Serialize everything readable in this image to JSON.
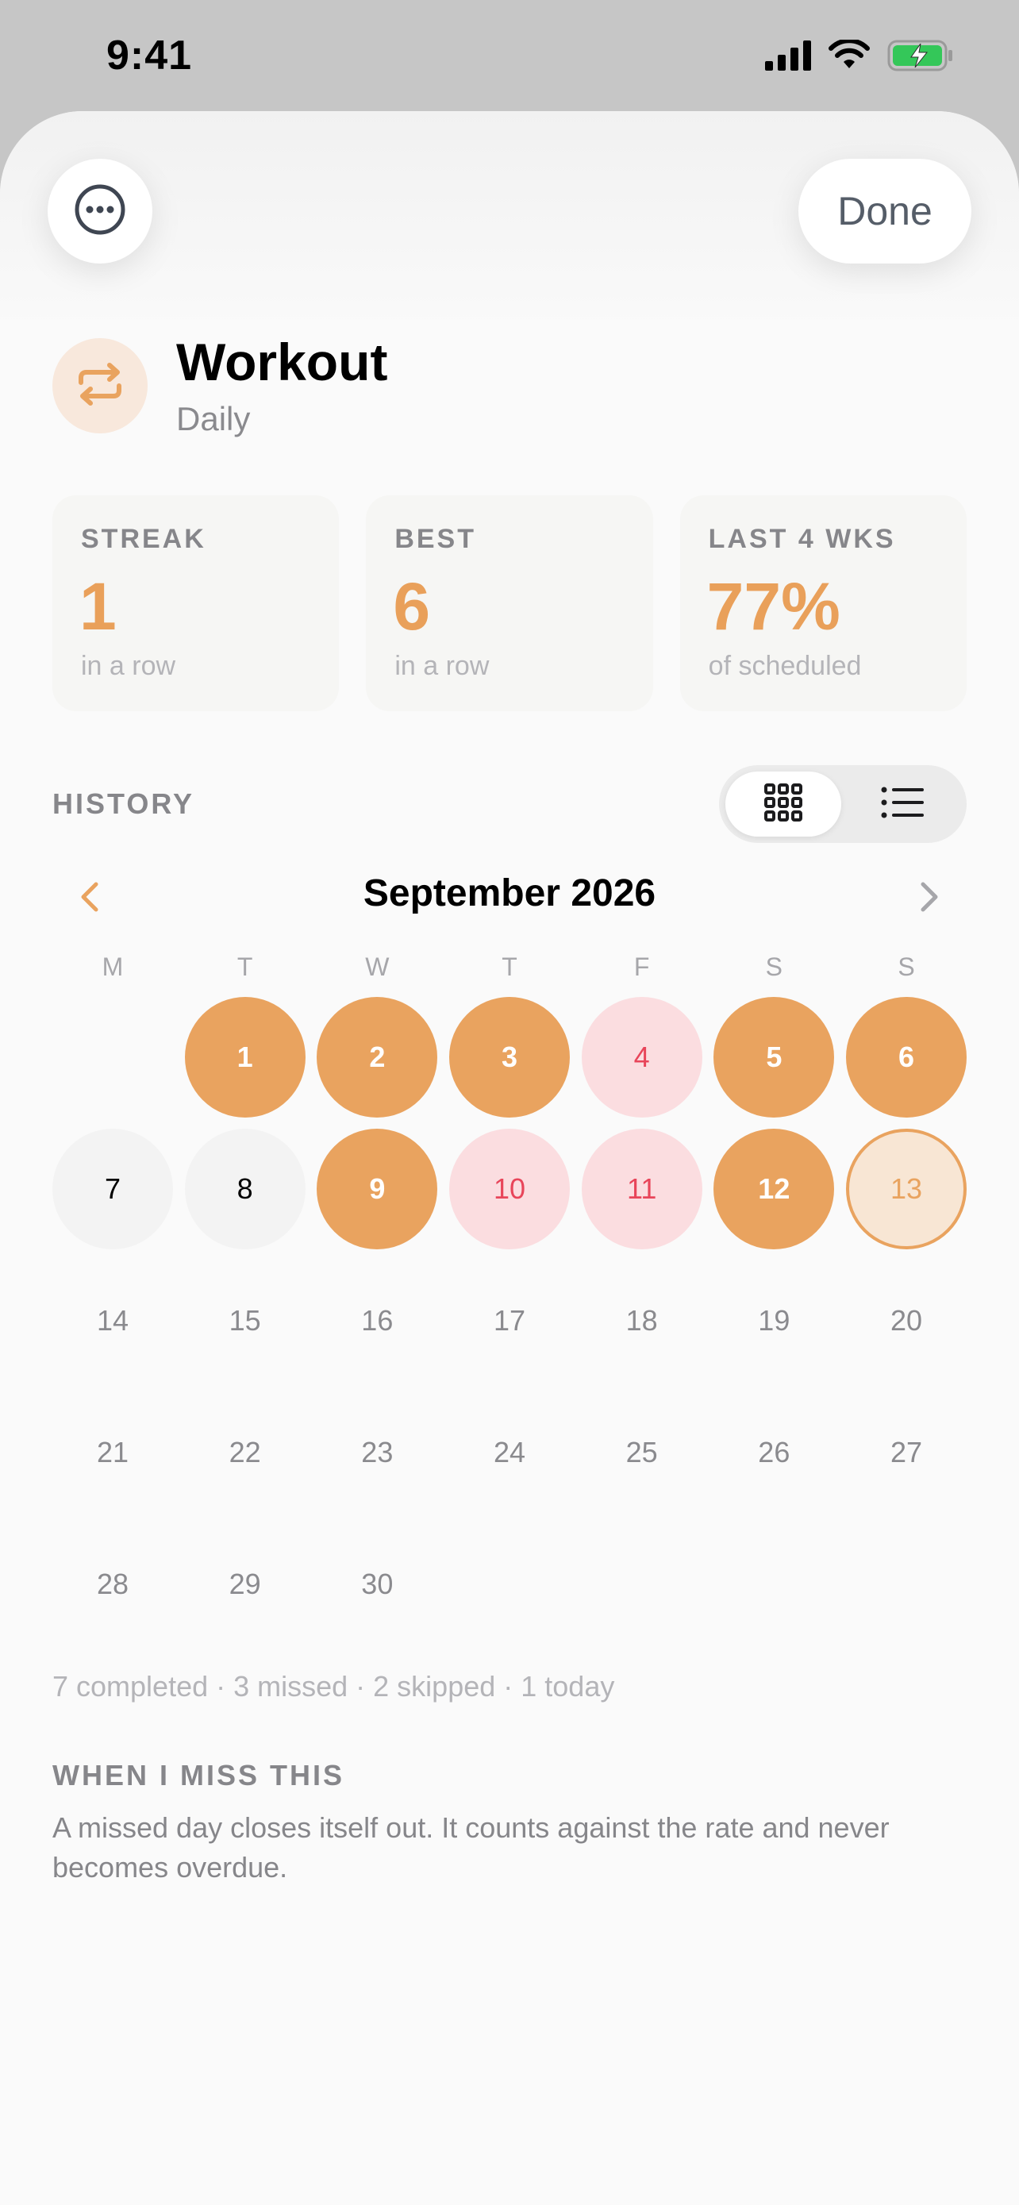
{
  "status_bar": {
    "time": "9:41"
  },
  "toolbar": {
    "done_label": "Done"
  },
  "habit": {
    "name": "Workout",
    "frequency": "Daily"
  },
  "stats": [
    {
      "label": "STREAK",
      "value": "1",
      "caption": "in a row"
    },
    {
      "label": "BEST",
      "value": "6",
      "caption": "in a row"
    },
    {
      "label": "LAST 4 WKS",
      "value": "77%",
      "caption": "of scheduled"
    }
  ],
  "history": {
    "label": "HISTORY",
    "view_mode": "grid",
    "month_title": "September 2026",
    "weekdays": [
      "M",
      "T",
      "W",
      "T",
      "F",
      "S",
      "S"
    ],
    "days": [
      {
        "day": "1",
        "state": "done"
      },
      {
        "day": "2",
        "state": "done"
      },
      {
        "day": "3",
        "state": "done"
      },
      {
        "day": "4",
        "state": "missed"
      },
      {
        "day": "5",
        "state": "done"
      },
      {
        "day": "6",
        "state": "done"
      },
      {
        "day": "7",
        "state": "skipped"
      },
      {
        "day": "8",
        "state": "skipped"
      },
      {
        "day": "9",
        "state": "done"
      },
      {
        "day": "10",
        "state": "missed"
      },
      {
        "day": "11",
        "state": "missed"
      },
      {
        "day": "12",
        "state": "done"
      },
      {
        "day": "13",
        "state": "today"
      },
      {
        "day": "14",
        "state": "future"
      },
      {
        "day": "15",
        "state": "future"
      },
      {
        "day": "16",
        "state": "future"
      },
      {
        "day": "17",
        "state": "future"
      },
      {
        "day": "18",
        "state": "future"
      },
      {
        "day": "19",
        "state": "future"
      },
      {
        "day": "20",
        "state": "future"
      },
      {
        "day": "21",
        "state": "future"
      },
      {
        "day": "22",
        "state": "future"
      },
      {
        "day": "23",
        "state": "future"
      },
      {
        "day": "24",
        "state": "future"
      },
      {
        "day": "25",
        "state": "future"
      },
      {
        "day": "26",
        "state": "future"
      },
      {
        "day": "27",
        "state": "future"
      },
      {
        "day": "28",
        "state": "future"
      },
      {
        "day": "29",
        "state": "future"
      },
      {
        "day": "30",
        "state": "future"
      }
    ],
    "summary": "7 completed · 3 missed · 2 skipped · 1 today"
  },
  "miss_policy": {
    "title": "WHEN I MISS THIS",
    "body": "A missed day closes itself out. It counts against the rate and never becomes overdue."
  },
  "colors": {
    "accent": "#e9a35f",
    "missed": "#e8455a",
    "missed_bg": "#fbdde0",
    "battery": "#34c759"
  }
}
